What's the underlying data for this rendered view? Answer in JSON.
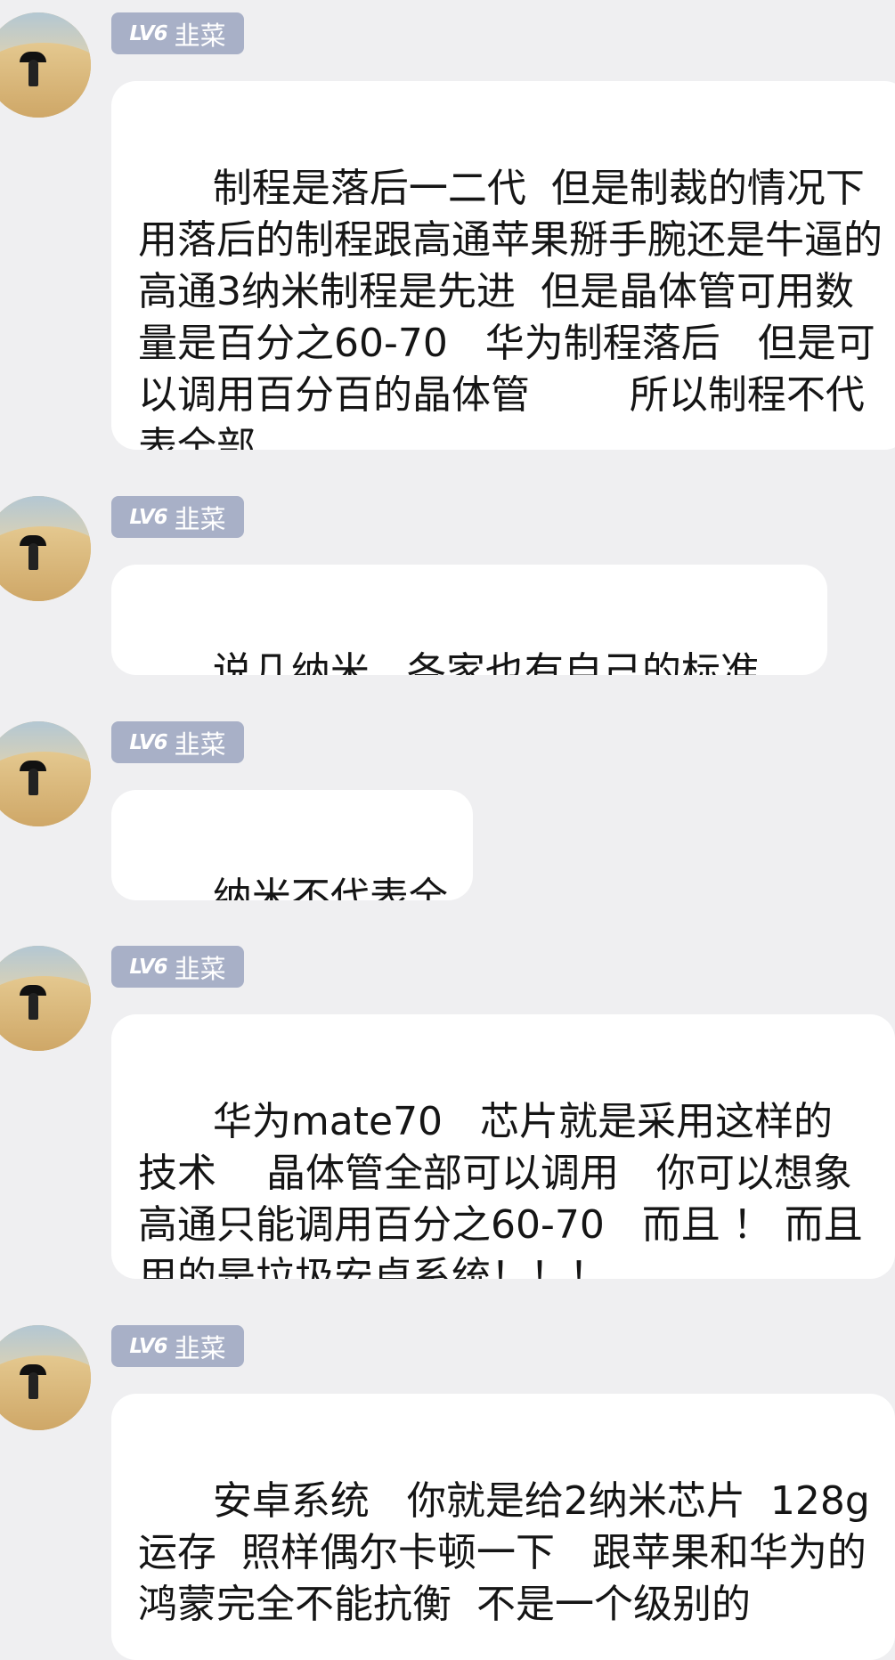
{
  "messages": [
    {
      "level": "LV6",
      "name": "韭菜",
      "text": "制程是落后一二代  但是制裁的情况下用落后的制程跟高通苹果掰手腕还是牛逼的   高通3纳米制程是先进  但是晶体管可用数量是百分之60-70   华为制程落后   但是可以调用百分百的晶体管        所以制程不代表全部"
    },
    {
      "level": "LV6",
      "name": "韭菜",
      "text": "说几纳米   各家也有自己的标准"
    },
    {
      "level": "LV6",
      "name": "韭菜",
      "text": "纳米不代表全部"
    },
    {
      "level": "LV6",
      "name": "韭菜",
      "text": "华为mate70   芯片就是采用这样的技术    晶体管全部可以调用   你可以想象   高通只能调用百分之60-70   而且 ！ 而且用的是垃圾安卓系统！！！"
    },
    {
      "level": "LV6",
      "name": "韭菜",
      "text": "安卓系统   你就是给2纳米芯片  128g运存  照样偶尔卡顿一下   跟苹果和华为的鸿蒙完全不能抗衡  不是一个级别的"
    }
  ]
}
